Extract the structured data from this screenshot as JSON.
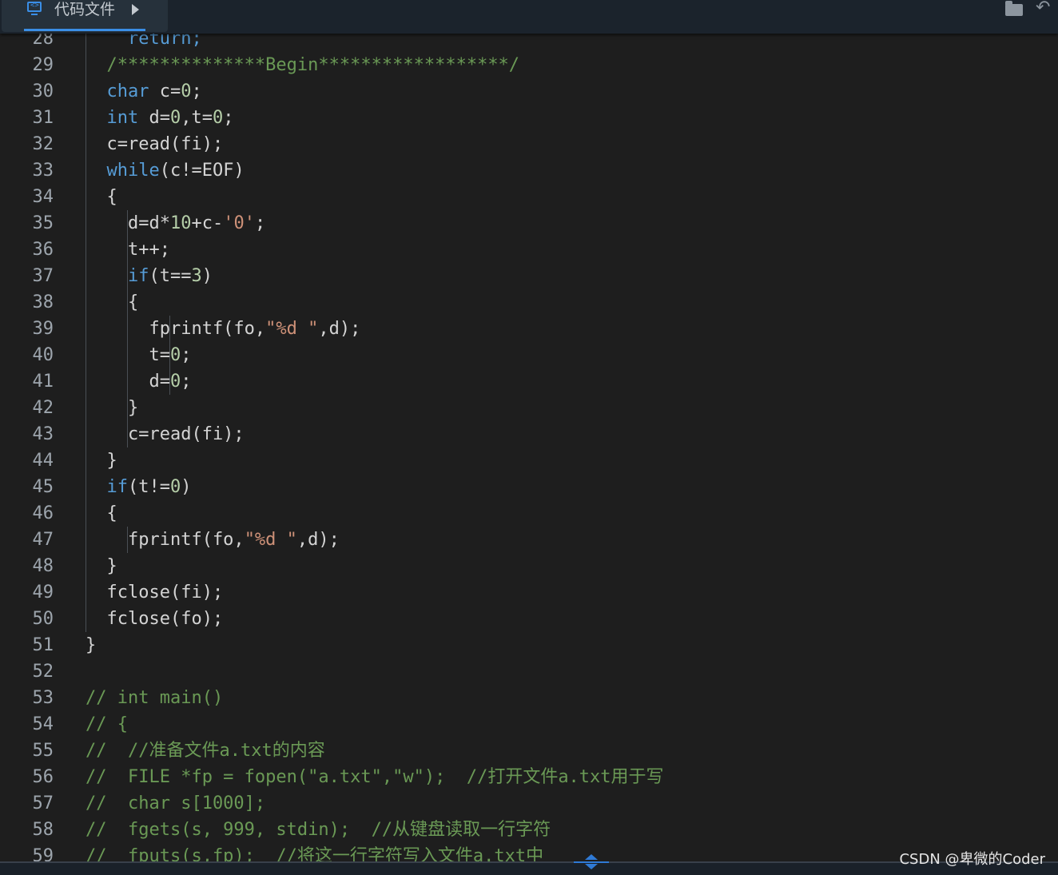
{
  "tab": {
    "label": "代码文件",
    "icon": "code-file-icon",
    "icon_glyph": "<>"
  },
  "toolbar": {
    "folder_icon": "folder-icon",
    "undo_icon": "undo-icon",
    "undo_glyph": "↶"
  },
  "colors": {
    "background": "#1e1e1e",
    "keyword": "#569cd6",
    "comment": "#6a9955",
    "string": "#ce9178",
    "number": "#b5cea8",
    "text": "#d4d4d4",
    "accent": "#3a8ee6"
  },
  "editor": {
    "lines": [
      {
        "n": "28",
        "segs": [
          {
            "t": "    return;",
            "c": "kw"
          }
        ]
      },
      {
        "n": "29",
        "segs": [
          {
            "t": "  /**************Begin******************/",
            "c": "cm"
          }
        ]
      },
      {
        "n": "30",
        "segs": [
          {
            "t": "  "
          },
          {
            "t": "char",
            "c": "kw"
          },
          {
            "t": " c="
          },
          {
            "t": "0",
            "c": "nm"
          },
          {
            "t": ";"
          }
        ]
      },
      {
        "n": "31",
        "segs": [
          {
            "t": "  "
          },
          {
            "t": "int",
            "c": "kw"
          },
          {
            "t": " d="
          },
          {
            "t": "0",
            "c": "nm"
          },
          {
            "t": ",t="
          },
          {
            "t": "0",
            "c": "nm"
          },
          {
            "t": ";"
          }
        ]
      },
      {
        "n": "32",
        "segs": [
          {
            "t": "  c=read(fi);"
          }
        ]
      },
      {
        "n": "33",
        "segs": [
          {
            "t": "  "
          },
          {
            "t": "while",
            "c": "kw"
          },
          {
            "t": "(c!=EOF)"
          }
        ]
      },
      {
        "n": "34",
        "segs": [
          {
            "t": "  {"
          }
        ]
      },
      {
        "n": "35",
        "segs": [
          {
            "t": "    d=d*"
          },
          {
            "t": "10",
            "c": "nm"
          },
          {
            "t": "+c-"
          },
          {
            "t": "'0'",
            "c": "st"
          },
          {
            "t": ";"
          }
        ]
      },
      {
        "n": "36",
        "segs": [
          {
            "t": "    t++;"
          }
        ]
      },
      {
        "n": "37",
        "segs": [
          {
            "t": "    "
          },
          {
            "t": "if",
            "c": "kw"
          },
          {
            "t": "(t=="
          },
          {
            "t": "3",
            "c": "nm"
          },
          {
            "t": ")"
          }
        ]
      },
      {
        "n": "38",
        "segs": [
          {
            "t": "    {"
          }
        ]
      },
      {
        "n": "39",
        "segs": [
          {
            "t": "      fprintf(fo,"
          },
          {
            "t": "\"%d \"",
            "c": "st"
          },
          {
            "t": ",d);"
          }
        ]
      },
      {
        "n": "40",
        "segs": [
          {
            "t": "      t="
          },
          {
            "t": "0",
            "c": "nm"
          },
          {
            "t": ";"
          }
        ]
      },
      {
        "n": "41",
        "segs": [
          {
            "t": "      d="
          },
          {
            "t": "0",
            "c": "nm"
          },
          {
            "t": ";"
          }
        ]
      },
      {
        "n": "42",
        "segs": [
          {
            "t": "    }"
          }
        ]
      },
      {
        "n": "43",
        "segs": [
          {
            "t": "    c=read(fi);"
          }
        ]
      },
      {
        "n": "44",
        "segs": [
          {
            "t": "  }"
          }
        ]
      },
      {
        "n": "45",
        "segs": [
          {
            "t": "  "
          },
          {
            "t": "if",
            "c": "kw"
          },
          {
            "t": "(t!="
          },
          {
            "t": "0",
            "c": "nm"
          },
          {
            "t": ")"
          }
        ]
      },
      {
        "n": "46",
        "segs": [
          {
            "t": "  {"
          }
        ]
      },
      {
        "n": "47",
        "segs": [
          {
            "t": "    fprintf(fo,"
          },
          {
            "t": "\"%d \"",
            "c": "st"
          },
          {
            "t": ",d);"
          }
        ]
      },
      {
        "n": "48",
        "segs": [
          {
            "t": "  }"
          }
        ]
      },
      {
        "n": "49",
        "segs": [
          {
            "t": "  fclose(fi);"
          }
        ]
      },
      {
        "n": "50",
        "segs": [
          {
            "t": "  fclose(fo);"
          }
        ]
      },
      {
        "n": "51",
        "segs": [
          {
            "t": "}"
          }
        ]
      },
      {
        "n": "52",
        "segs": []
      },
      {
        "n": "53",
        "segs": [
          {
            "t": "// int main()",
            "c": "cm"
          }
        ]
      },
      {
        "n": "54",
        "segs": [
          {
            "t": "// {",
            "c": "cm"
          }
        ]
      },
      {
        "n": "55",
        "segs": [
          {
            "t": "//  //准备文件a.txt的内容",
            "c": "cm"
          }
        ]
      },
      {
        "n": "56",
        "segs": [
          {
            "t": "//  FILE *fp = fopen(\"a.txt\",\"w\");  //打开文件a.txt用于写",
            "c": "cm"
          }
        ]
      },
      {
        "n": "57",
        "segs": [
          {
            "t": "//  char s[1000];",
            "c": "cm"
          }
        ]
      },
      {
        "n": "58",
        "segs": [
          {
            "t": "//  fgets(s, 999, stdin);  //从键盘读取一行字符",
            "c": "cm"
          }
        ]
      },
      {
        "n": "59",
        "segs": [
          {
            "t": "//  fputs(s,fp);  //将这一行字符写入文件a.txt中",
            "c": "cm"
          }
        ]
      }
    ]
  },
  "watermark": "CSDN @卑微的Coder"
}
